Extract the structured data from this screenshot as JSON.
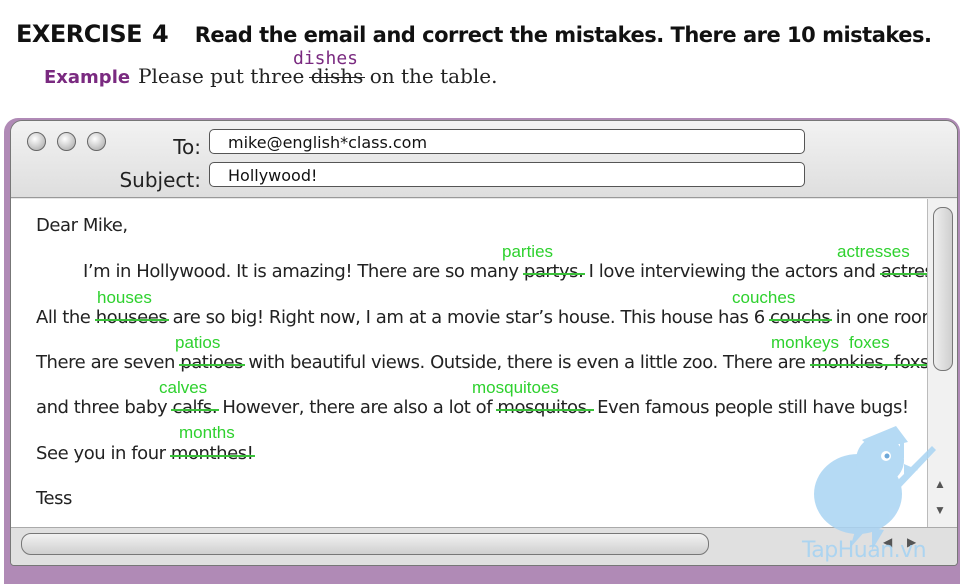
{
  "exercise": {
    "label": "EXERCISE",
    "number": "4",
    "instruction": "Read the email and correct the mistakes. There are 10 mistakes."
  },
  "example": {
    "label": "Example",
    "before": "Please put three",
    "wrong": "dishs",
    "after": "on the table.",
    "correction": "dishes"
  },
  "email": {
    "to_label": "To:",
    "to_value": "mike@english*class.com",
    "subject_label": "Subject:",
    "subject_value": "Hollywood!",
    "greeting": "Dear Mike,",
    "line1": {
      "a": "I’m in Hollywood. It is amazing! There are so many ",
      "e1": "partys.",
      "b": " I love interviewing the actors and ",
      "e2": "actress’s."
    },
    "line2": {
      "a": "All the ",
      "e1": "housees",
      "b": " are so big! Right now, I am at a movie star’s house. This house has 6 ",
      "e2": "couchs",
      "c": " in one room!"
    },
    "line3": {
      "a": "There are seven ",
      "e1": "patioes",
      "b": " with beautiful views. Outside, there is even a little zoo. There are ",
      "e2": "monkies, foxs,"
    },
    "line4": {
      "a": "and three baby ",
      "e1": "calfs.",
      "b": " However, there are also a lot of ",
      "e2": "mosquitos.",
      "c": " Even famous people still have bugs!"
    },
    "line5": {
      "a": "See you in four ",
      "e1": "monthes!"
    },
    "signoff": "Tess"
  },
  "corrections": {
    "parties": "parties",
    "actresses": "actresses",
    "houses": "houses",
    "couches": "couches",
    "patios": "patios",
    "monkeys": "monkeys",
    "foxes": "foxes",
    "calves": "calves",
    "mosquitoes": "mosquitoes",
    "months": "months"
  },
  "colors": {
    "correction": "#2ed12e",
    "example_label": "#7a2a80",
    "window_frame": "#b08ab6"
  },
  "icons": {
    "scroll_up": "▲",
    "scroll_down": "▼",
    "scroll_left": "◀",
    "scroll_right": "▶"
  },
  "watermark": "TapHuan.vn"
}
